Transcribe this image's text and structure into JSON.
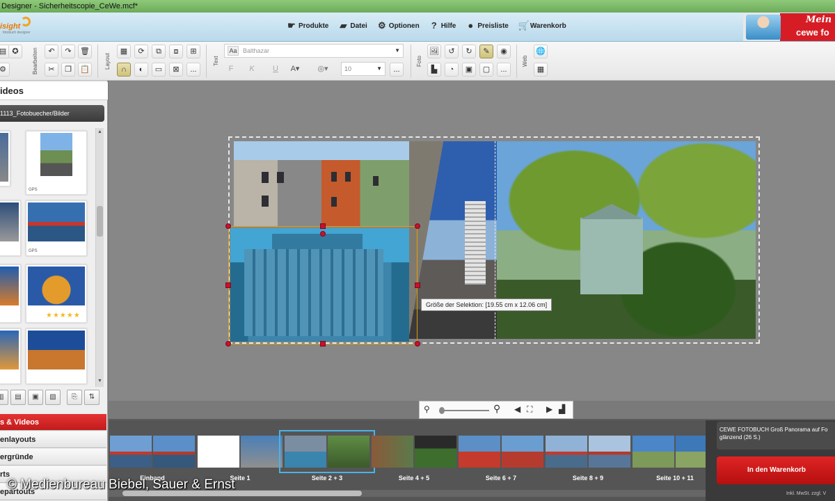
{
  "window": {
    "title": "Designer - Sicherheitscopie_CeWe.mcf*"
  },
  "brand": {
    "logo_text": "isight",
    "logo_sub": "fotobuch designer",
    "banner_top": "Mein",
    "banner_brand": "cewe fo"
  },
  "menu": {
    "items": [
      {
        "label": "Produkte",
        "icon": "pointer-icon"
      },
      {
        "label": "Datei",
        "icon": "folder-icon"
      },
      {
        "label": "Optionen",
        "icon": "gear-icon"
      },
      {
        "label": "Hilfe",
        "icon": "question-icon"
      },
      {
        "label": "Preisliste",
        "icon": "coins-icon"
      },
      {
        "label": "Warenkorb",
        "icon": "cart-icon"
      }
    ]
  },
  "toolbar": {
    "groups": {
      "edit": "Bearbeiten",
      "layout": "Layout",
      "text": "Text",
      "photo": "Foto",
      "web": "Web"
    },
    "font_name": "Balthazar",
    "font_size": "10",
    "bold": "F",
    "italic": "K",
    "underline": "U",
    "more": "..."
  },
  "left_panel": {
    "header": "ideos",
    "path": "1113_Fotobuecher/Bilder",
    "thumb_caption": "GPS",
    "stars": "★★★★★",
    "tabs": [
      {
        "label": "s & Videos",
        "active": true
      },
      {
        "label": "enlayouts",
        "active": false
      },
      {
        "label": "ergründe",
        "active": false
      },
      {
        "label": "rts",
        "active": false
      },
      {
        "label": "epartouts",
        "active": false
      }
    ]
  },
  "canvas": {
    "selection_tooltip": "Größe der Selektion: [19.55 cm x 12.06 cm]"
  },
  "filmstrip": {
    "pages": [
      {
        "label": "Einband",
        "active": false
      },
      {
        "label": "Seite 1",
        "active": false
      },
      {
        "label": "Seite 2 + 3",
        "active": true
      },
      {
        "label": "Seite 4 + 5",
        "active": false
      },
      {
        "label": "Seite 6 + 7",
        "active": false
      },
      {
        "label": "Seite 8 + 9",
        "active": false
      },
      {
        "label": "Seite 10 + 11",
        "active": false
      }
    ]
  },
  "product": {
    "description": "CEWE FOTOBUCH Groß Panorama auf Fo glänzend  (26 S.)",
    "cart_button": "In den Warenkorb",
    "vat_note": "Inkl. MwSt. zzgl. V"
  },
  "watermark": {
    "copyright": "© Medienbureau Biebel, Sauer & Ernst"
  },
  "colors": {
    "accent_red": "#d61d25",
    "selection_blue": "#4ab4e6",
    "handle_red": "#c8102e"
  }
}
